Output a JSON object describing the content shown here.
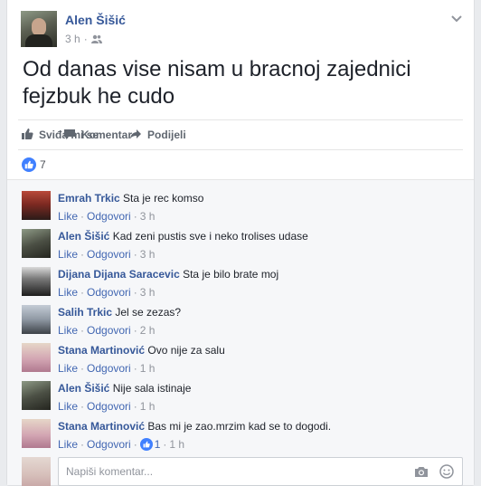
{
  "post": {
    "author": "Alen Šišić",
    "time": "3 h",
    "audience_icon": "friends-icon",
    "text": "Od danas vise nisam u bracnoj zajednici fejzbuk he cudo"
  },
  "actions": {
    "like_label": "Sviđa mi se",
    "comment_label": "Komentar",
    "share_label": "Podijeli"
  },
  "reactions": {
    "count": "7"
  },
  "comment_links": {
    "like": "Like",
    "reply": "Odgovori",
    "separator": "·"
  },
  "comments": [
    {
      "author": "Emrah Trkic",
      "text": "Sta je rec komso",
      "time": "3 h",
      "likes": ""
    },
    {
      "author": "Alen Šišić",
      "text": "Kad zeni pustis sve i neko trolises udase",
      "time": "3 h",
      "likes": ""
    },
    {
      "author": "Dijana Dijana Saracevic",
      "text": "Sta je bilo brate moj",
      "time": "3 h",
      "likes": ""
    },
    {
      "author": "Salih Trkic",
      "text": "Jel se zezas?",
      "time": "2 h",
      "likes": ""
    },
    {
      "author": "Stana Martinović",
      "text": "Ovo nije za salu",
      "time": "1 h",
      "likes": ""
    },
    {
      "author": "Alen Šišić",
      "text": "Nije sala istinaje",
      "time": "1 h",
      "likes": ""
    },
    {
      "author": "Stana Martinović",
      "text": "Bas mi je zao.mrzim kad se to dogodi.",
      "time": "1 h",
      "likes": "1"
    }
  ],
  "composer": {
    "placeholder": "Napiši komentar..."
  },
  "colors": {
    "link": "#365899",
    "accent": "#4080ff",
    "meta": "#90949c"
  }
}
